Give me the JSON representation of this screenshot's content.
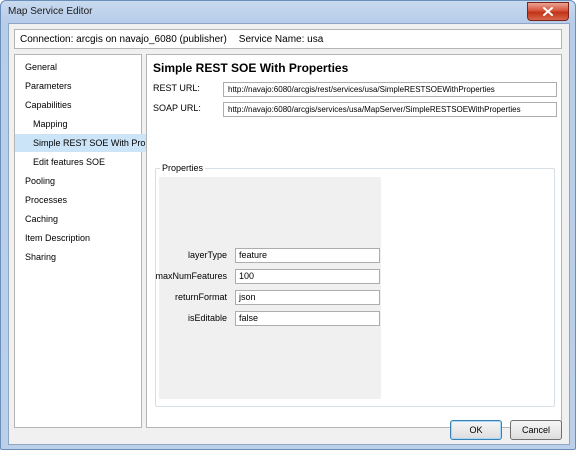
{
  "window": {
    "title": "Map Service Editor"
  },
  "connection": {
    "text": "Connection: arcgis on navajo_6080 (publisher)",
    "service": "Service Name: usa"
  },
  "sidebar": {
    "items": [
      {
        "label": "General",
        "indent": false,
        "selected": false
      },
      {
        "label": "Parameters",
        "indent": false,
        "selected": false
      },
      {
        "label": "Capabilities",
        "indent": false,
        "selected": false
      },
      {
        "label": "Mapping",
        "indent": true,
        "selected": false
      },
      {
        "label": "Simple REST SOE With Pro",
        "indent": true,
        "selected": true
      },
      {
        "label": "Edit features SOE",
        "indent": true,
        "selected": false
      },
      {
        "label": "Pooling",
        "indent": false,
        "selected": false
      },
      {
        "label": "Processes",
        "indent": false,
        "selected": false
      },
      {
        "label": "Caching",
        "indent": false,
        "selected": false
      },
      {
        "label": "Item Description",
        "indent": false,
        "selected": false
      },
      {
        "label": "Sharing",
        "indent": false,
        "selected": false
      }
    ]
  },
  "content": {
    "heading": "Simple REST SOE With Properties",
    "rest_label": "REST URL:",
    "rest_url": "http://navajo:6080/arcgis/rest/services/usa/SimpleRESTSOEWithProperties",
    "soap_label": "SOAP URL:",
    "soap_url": "http://navajo:6080/arcgis/services/usa/MapServer/SimpleRESTSOEWithProperties",
    "properties_legend": "Properties",
    "properties": [
      {
        "name": "layerType",
        "value": "feature"
      },
      {
        "name": "maxNumFeatures",
        "value": "100"
      },
      {
        "name": "returnFormat",
        "value": "json"
      },
      {
        "name": "isEditable",
        "value": "false"
      }
    ]
  },
  "buttons": {
    "ok": "OK",
    "cancel": "Cancel"
  },
  "colors": {
    "selection": "#cce4f7",
    "close_button": "#c23318"
  }
}
